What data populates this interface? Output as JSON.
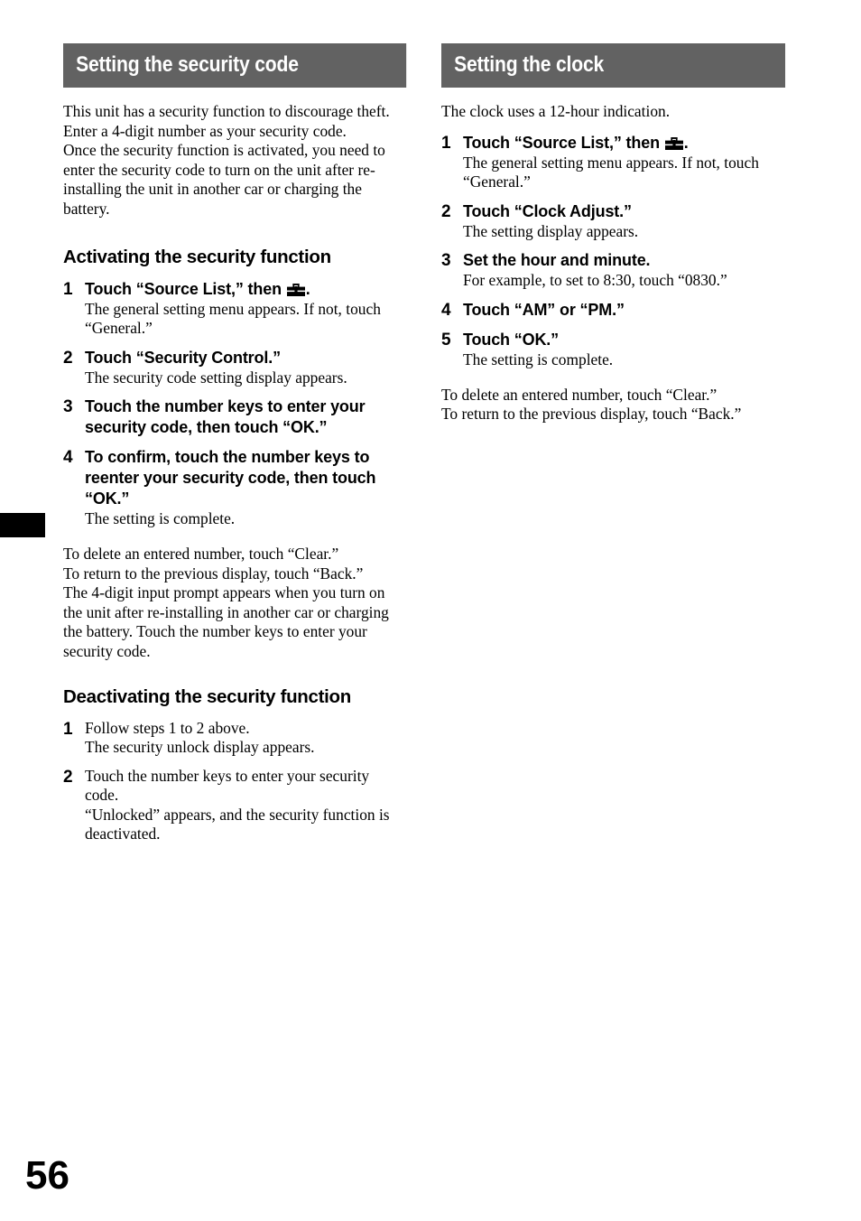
{
  "page": {
    "folio": "56",
    "edge_tab_color": "#000000",
    "section_bar_color": "#626262"
  },
  "left_column": {
    "section_title": "Setting the security code",
    "intro_paragraphs": [
      "This unit has a security function to discourage theft. Enter a 4-digit number as your security code.",
      "Once the security function is activated, you need to enter the security code to turn on the unit after re-installing the unit in another car or charging the battery."
    ],
    "activating": {
      "heading": "Activating the security function",
      "steps": [
        {
          "num": "1",
          "title_before_icon": "Touch “Source List,” then ",
          "icon": "toolbox-icon",
          "title_after_icon": ".",
          "desc": "The general setting menu appears. If not, touch “General.”"
        },
        {
          "num": "2",
          "title": "Touch “Security Control.”",
          "desc": "The security code setting display appears."
        },
        {
          "num": "3",
          "title": "Touch the number keys to enter your security code, then touch “OK.”",
          "desc": ""
        },
        {
          "num": "4",
          "title": "To confirm, touch the number keys to reenter your security code, then touch “OK.”",
          "desc": "The setting is complete."
        }
      ],
      "note_lines": [
        "To delete an entered number, touch “Clear.”",
        "To return to the previous display, touch “Back.”"
      ],
      "note_paragraph": "The 4-digit input prompt appears when you turn on the unit after re-installing in another car or charging the battery. Touch the number keys to enter your security code."
    },
    "deactivating": {
      "heading": "Deactivating the security function",
      "steps": [
        {
          "num": "1",
          "title": "Follow steps 1 to 2 above.",
          "desc": "The security unlock display appears."
        },
        {
          "num": "2",
          "title": "Touch the number keys to enter your security code.",
          "desc": "“Unlocked” appears, and the security function is deactivated."
        }
      ]
    }
  },
  "right_column": {
    "section_title": "Setting the clock",
    "intro_paragraph": "The clock uses a 12-hour indication.",
    "steps": [
      {
        "num": "1",
        "title_before_icon": "Touch “Source List,” then ",
        "icon": "toolbox-icon",
        "title_after_icon": ".",
        "desc": "The general setting menu appears. If not, touch “General.”"
      },
      {
        "num": "2",
        "title": "Touch “Clock Adjust.”",
        "desc": "The setting display appears."
      },
      {
        "num": "3",
        "title": "Set the hour and minute.",
        "desc": "For example, to set to 8:30, touch “0830.”"
      },
      {
        "num": "4",
        "title": "Touch “AM” or “PM.”",
        "desc": ""
      },
      {
        "num": "5",
        "title": "Touch “OK.”",
        "desc": "The setting is complete."
      }
    ],
    "note_lines": [
      "To delete an entered number, touch “Clear.”",
      "To return to the previous display, touch “Back.”"
    ]
  }
}
